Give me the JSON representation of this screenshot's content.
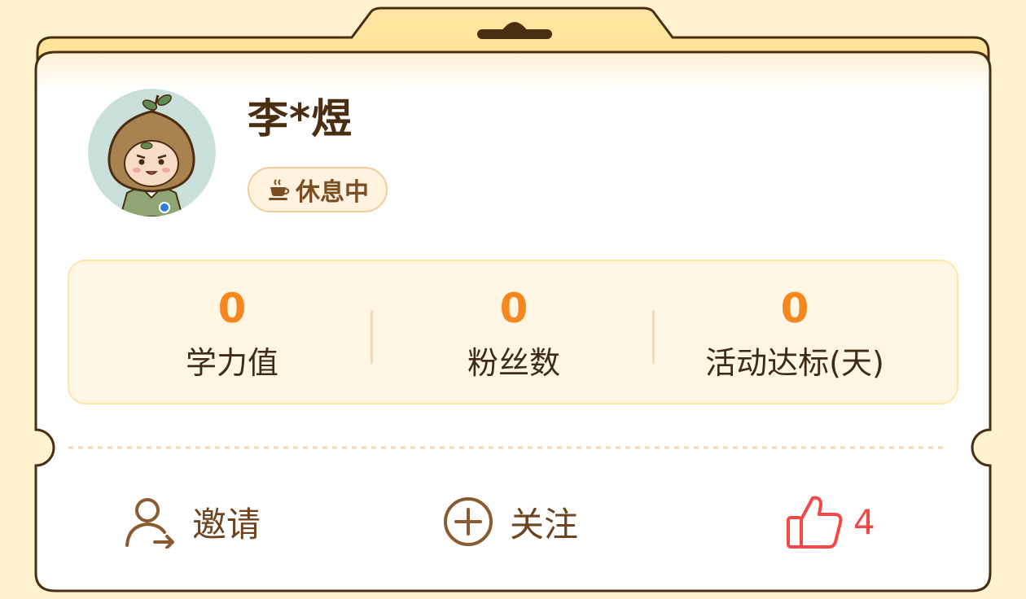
{
  "profile": {
    "name": "李*煜",
    "status_label": "休息中",
    "status_icon": "coffee-cup-icon",
    "avatar_icon": "onion-mascot-avatar"
  },
  "stats": [
    {
      "value": "0",
      "label": "学力值"
    },
    {
      "value": "0",
      "label": "粉丝数"
    },
    {
      "value": "0",
      "label": "活动达标(天)"
    }
  ],
  "actions": {
    "invite_label": "邀请",
    "invite_icon": "add-user-icon",
    "follow_label": "关注",
    "follow_icon": "plus-circle-icon",
    "like_count": "4",
    "like_icon": "thumbs-up-icon"
  },
  "colors": {
    "page_bg": "#FFF3CF",
    "card_border": "#4A2E12",
    "accent_orange": "#F5871F",
    "text_brown": "#6E4420",
    "like_red": "#F24848"
  }
}
